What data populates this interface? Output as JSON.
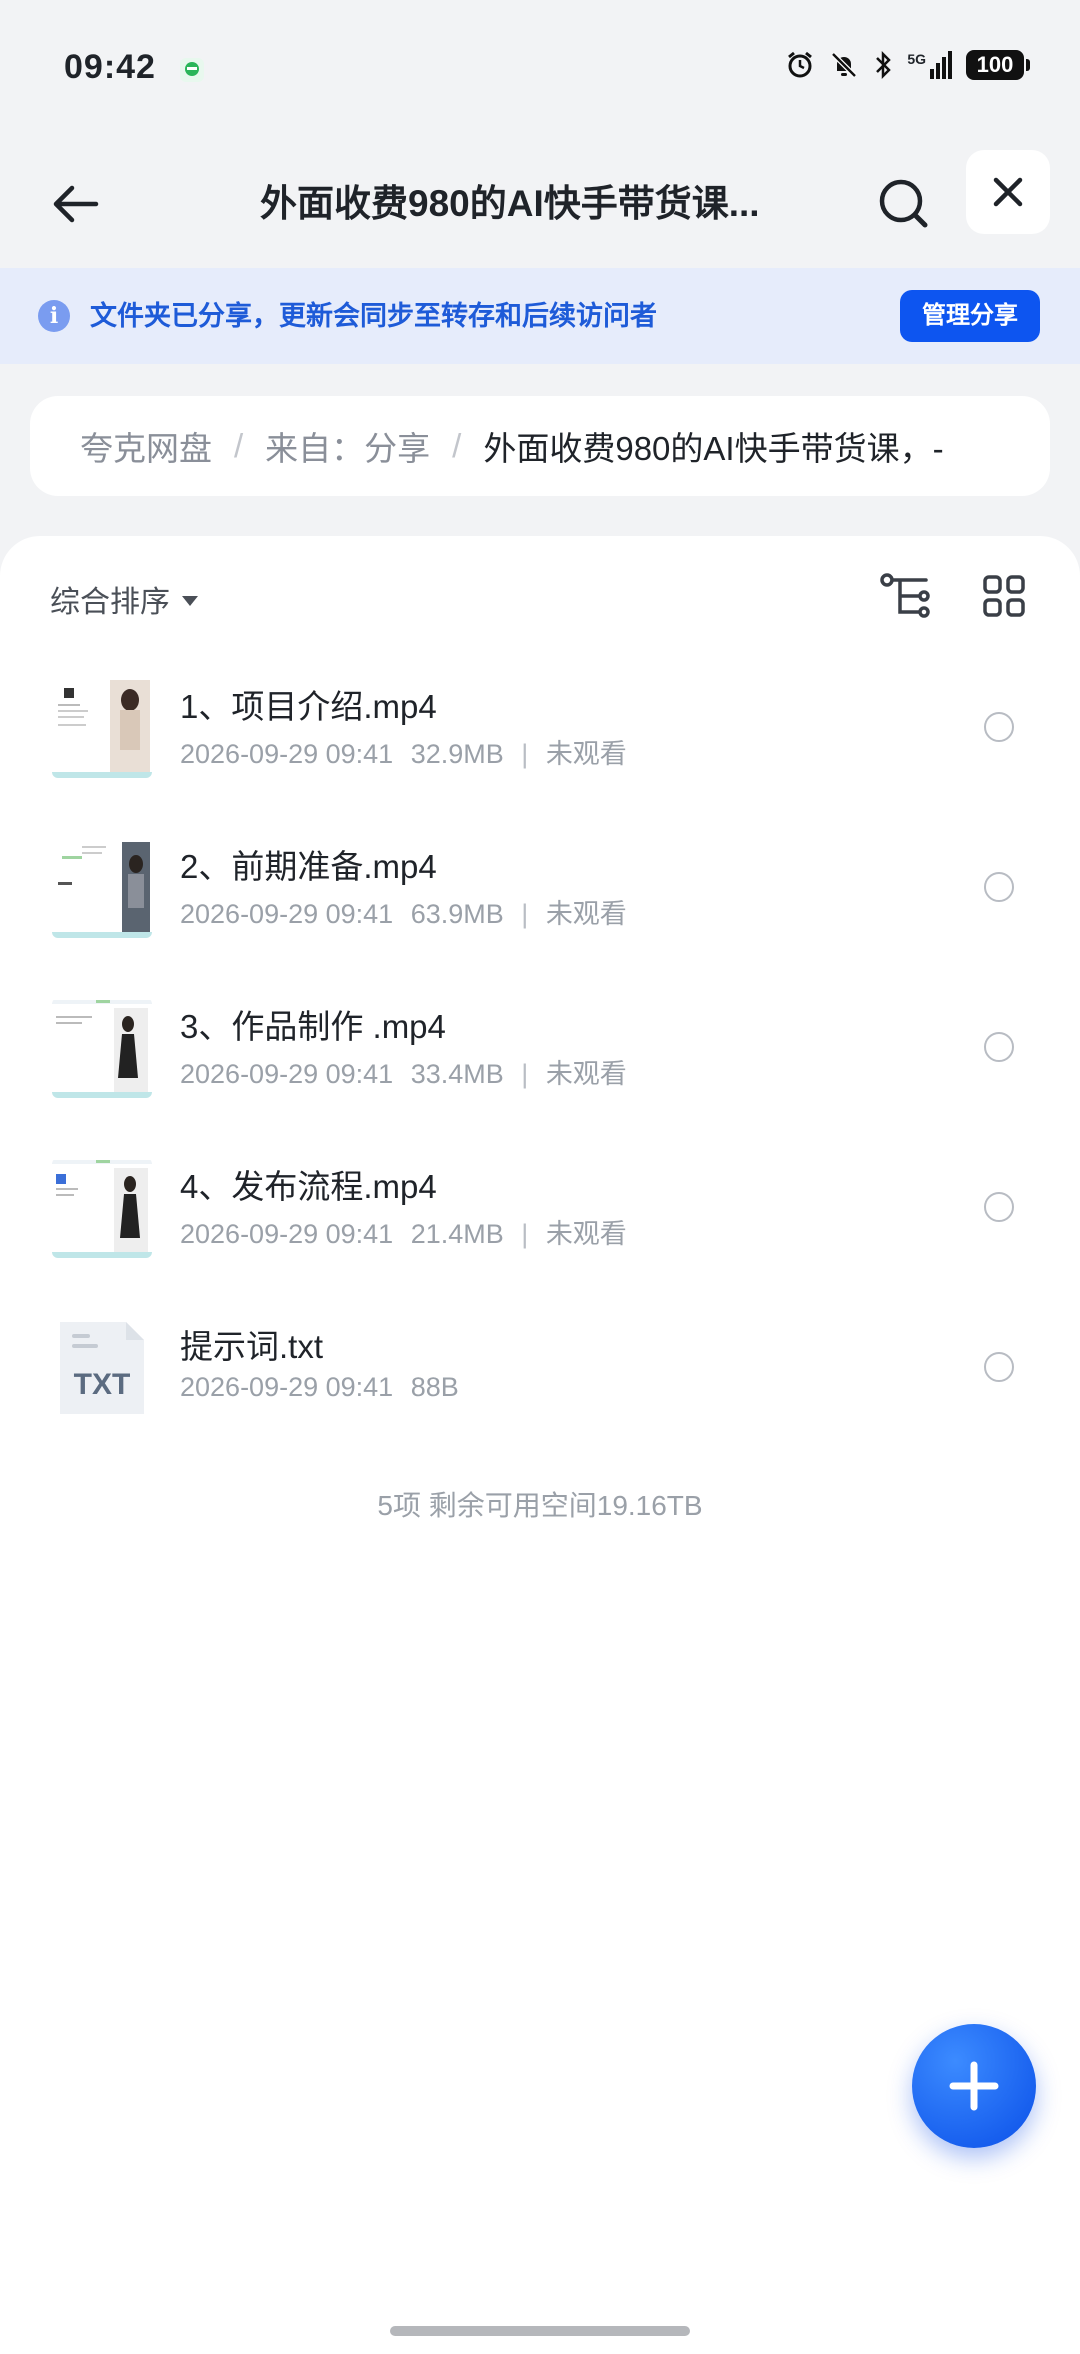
{
  "status_bar": {
    "time": "09:42",
    "network": "5G",
    "battery": "100"
  },
  "header": {
    "title": "外面收费980的AI快手带货课..."
  },
  "share_banner": {
    "text": "文件夹已分享，更新会同步至转存和后续访问者",
    "manage_button": "管理分享"
  },
  "breadcrumb": {
    "items": [
      "夸克网盘",
      "来自：分享",
      "外面收费980的AI快手带货课，-"
    ],
    "separator": "/"
  },
  "toolbar": {
    "sort_label": "综合排序"
  },
  "files": [
    {
      "name": "1、项目介绍.mp4",
      "date": "2026-09-29 09:41",
      "size": "32.9MB",
      "status": "未观看",
      "type": "video"
    },
    {
      "name": "2、前期准备.mp4",
      "date": "2026-09-29 09:41",
      "size": "63.9MB",
      "status": "未观看",
      "type": "video"
    },
    {
      "name": "3、作品制作 .mp4",
      "date": "2026-09-29 09:41",
      "size": "33.4MB",
      "status": "未观看",
      "type": "video"
    },
    {
      "name": "4、发布流程.mp4",
      "date": "2026-09-29 09:41",
      "size": "21.4MB",
      "status": "未观看",
      "type": "video"
    },
    {
      "name": "提示词.txt",
      "date": "2026-09-29 09:41",
      "size": "88B",
      "status": "",
      "type": "txt",
      "icon_label": "TXT"
    }
  ],
  "summary": "5项 剩余可用空间19.16TB",
  "colors": {
    "accent": "#0d55f0",
    "banner_bg": "#e6ecfb",
    "banner_text": "#1e5bd8",
    "page_bg": "#f2f3f5"
  },
  "icons": [
    "back-arrow-icon",
    "search-icon",
    "close-icon",
    "info-icon",
    "tree-view-icon",
    "grid-view-icon",
    "plus-icon"
  ]
}
